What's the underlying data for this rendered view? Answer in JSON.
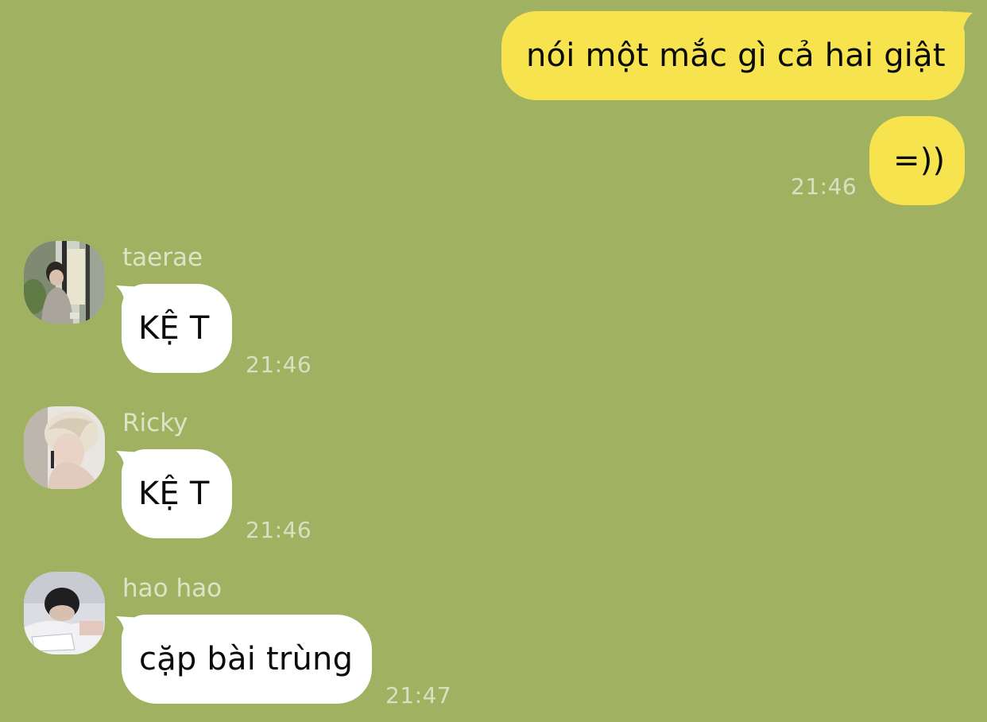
{
  "outgoing": [
    {
      "text": "nói một mắc gì cả hai giật",
      "time": ""
    },
    {
      "text": "=))",
      "time": "21:46"
    }
  ],
  "incoming": [
    {
      "sender": "taerae",
      "text": "KỆ T",
      "time": "21:46",
      "avatar": "taerae-avatar"
    },
    {
      "sender": "Ricky",
      "text": "KỆ T",
      "time": "21:46",
      "avatar": "ricky-avatar"
    },
    {
      "sender": "hao hao",
      "text": "cặp bài trùng",
      "time": "21:47",
      "avatar": "hao-hao-avatar"
    }
  ],
  "colors": {
    "background": "#a0b262",
    "outgoing_bubble": "#f6e34d",
    "incoming_bubble": "#ffffff",
    "meta_text": "#d9e0c0"
  }
}
